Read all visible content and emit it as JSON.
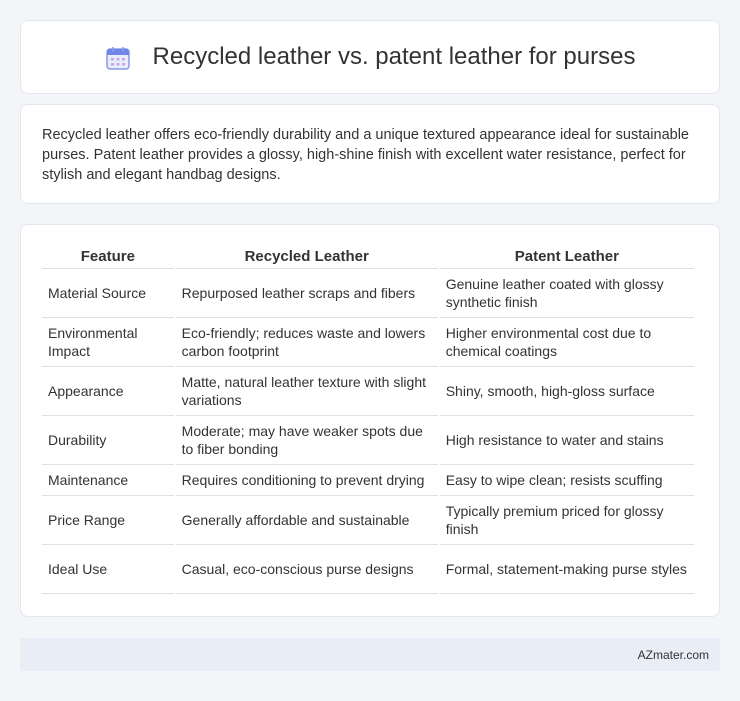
{
  "header": {
    "title": "Recycled leather vs. patent leather for purses",
    "icon": "calendar-icon"
  },
  "summary": {
    "text": "Recycled leather offers eco-friendly durability and a unique textured appearance ideal for sustainable purses. Patent leather provides a glossy, high-shine finish with excellent water resistance, perfect for stylish and elegant handbag designs."
  },
  "table": {
    "headers": [
      "Feature",
      "Recycled Leather",
      "Patent Leather"
    ],
    "rows": [
      [
        "Material Source",
        "Repurposed leather scraps and fibers",
        "Genuine leather coated with glossy synthetic finish"
      ],
      [
        "Environmental Impact",
        "Eco-friendly; reduces waste and lowers carbon footprint",
        "Higher environmental cost due to chemical coatings"
      ],
      [
        "Appearance",
        "Matte, natural leather texture with slight variations",
        "Shiny, smooth, high-gloss surface"
      ],
      [
        "Durability",
        "Moderate; may have weaker spots due to fiber bonding",
        "High resistance to water and stains"
      ],
      [
        "Maintenance",
        "Requires conditioning to prevent drying",
        "Easy to wipe clean; resists scuffing"
      ],
      [
        "Price Range",
        "Generally affordable and sustainable",
        "Typically premium priced for glossy finish"
      ],
      [
        "Ideal Use",
        "Casual, eco-conscious purse designs",
        "Formal, statement-making purse styles"
      ]
    ]
  },
  "footer": {
    "text": "AZmater.com"
  },
  "colors": {
    "background": "#f3f5f9",
    "card": "#ffffff",
    "border": "#dde1e7",
    "footer_bg": "#e9edf6",
    "icon_accent": "#7b8fe0"
  }
}
